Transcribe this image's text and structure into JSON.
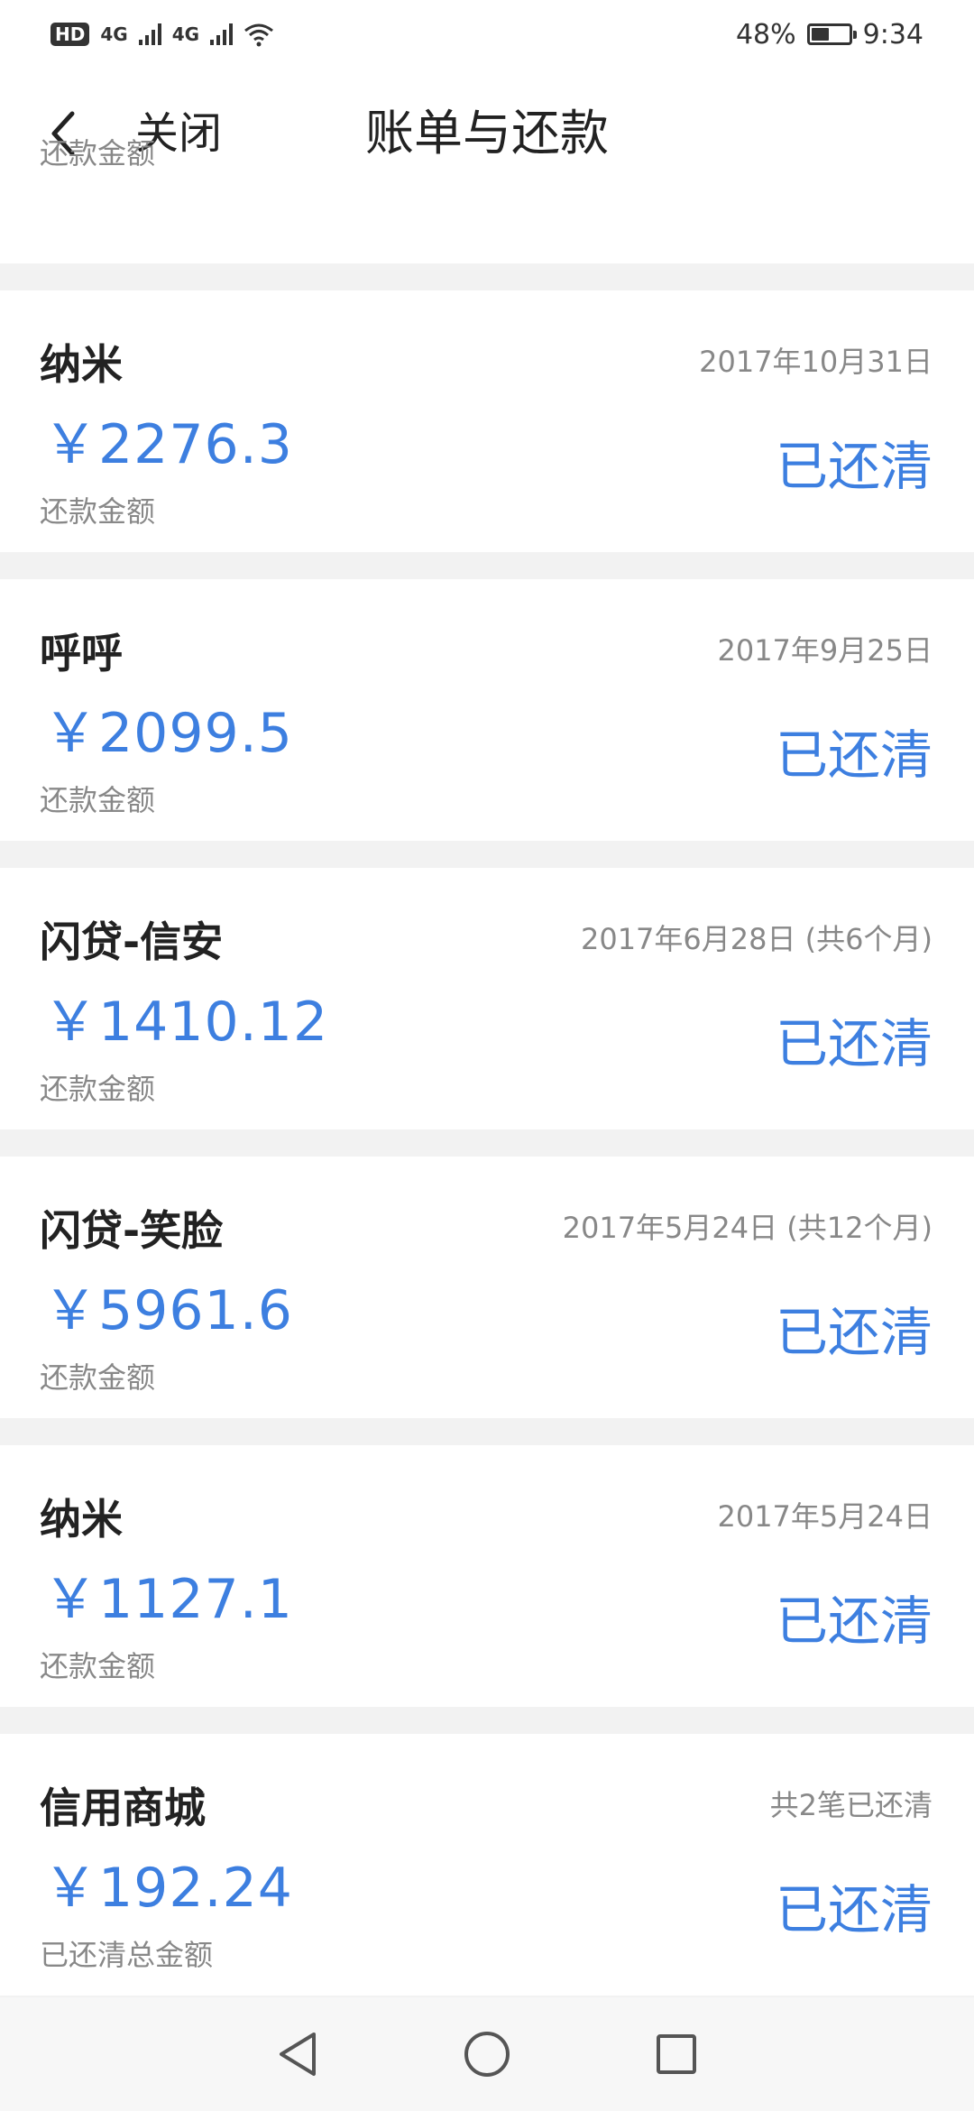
{
  "status_bar": {
    "hd": "HD",
    "sim1": "4G",
    "sim2": "4G",
    "battery_text": "48%",
    "battery_level": 0.48,
    "time": "9:34"
  },
  "header": {
    "close_label": "关闭",
    "title": "账单与还款",
    "partial_label": "还款金额"
  },
  "colors": {
    "accent": "#3d7fe0",
    "muted": "#888888",
    "background": "#f2f2f2"
  },
  "records": [
    {
      "name": "纳米",
      "date": "2017年10月31日",
      "amount": "￥2276.3",
      "sub": "还款金额",
      "status": "已还清"
    },
    {
      "name": "呼呼",
      "date": "2017年9月25日",
      "amount": "￥2099.5",
      "sub": "还款金额",
      "status": "已还清"
    },
    {
      "name": "闪贷-信安",
      "date": "2017年6月28日 (共6个月)",
      "amount": "￥1410.12",
      "sub": "还款金额",
      "status": "已还清"
    },
    {
      "name": "闪贷-笑脸",
      "date": "2017年5月24日 (共12个月)",
      "amount": "￥5961.6",
      "sub": "还款金额",
      "status": "已还清"
    },
    {
      "name": "纳米",
      "date": "2017年5月24日",
      "amount": "￥1127.1",
      "sub": "还款金额",
      "status": "已还清"
    },
    {
      "name": "信用商城",
      "date": "共2笔已还清",
      "amount": "￥192.24",
      "sub": "已还清总金额",
      "status": "已还清"
    }
  ],
  "icons": {
    "back": "chevron-left-icon",
    "nav_back": "triangle-back-icon",
    "nav_home": "circle-home-icon",
    "nav_recent": "square-recent-icon"
  }
}
